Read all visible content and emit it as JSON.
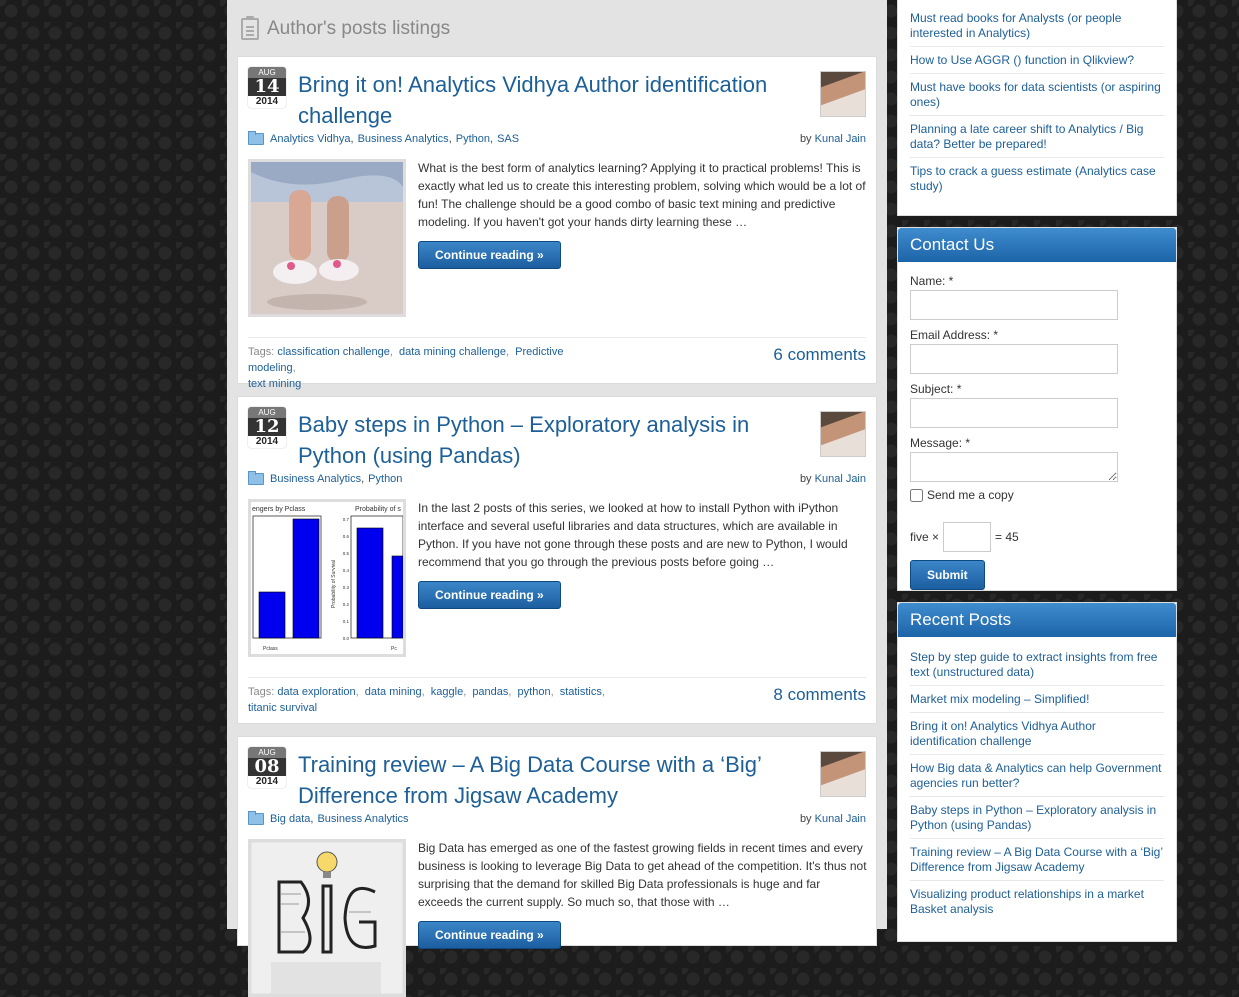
{
  "listing": {
    "title": "Author's posts listings"
  },
  "posts": [
    {
      "month": "AUG",
      "day": "14",
      "year": "2014",
      "title": "Bring it on! Analytics Vidhya Author identification challenge",
      "categories": [
        "Analytics Vidhya",
        "Business Analytics",
        "Python",
        "SAS"
      ],
      "by": "by",
      "author": "Kunal Jain",
      "excerpt": "What is the best form of analytics learning? Applying it to practical problems! This is exactly what led us to create this interesting problem, solving which would be a lot of fun! The challenge should be a good combo of basic text mining and predictive modeling. If you haven't got your hands dirty learning these …",
      "continue_label": "Continue reading »",
      "tags_label": "Tags:",
      "tags": [
        "classification challenge",
        "data mining challenge",
        "Predictive modeling",
        "text mining"
      ],
      "comments": "6 comments"
    },
    {
      "month": "AUG",
      "day": "12",
      "year": "2014",
      "title": "Baby steps in Python – Exploratory analysis in Python (using Pandas)",
      "categories": [
        "Business Analytics",
        "Python"
      ],
      "by": "by",
      "author": "Kunal Jain",
      "excerpt": "In the last 2 posts of this series, we looked at how to install Python with iPython interface and several useful libraries and data structures, which are available in Python. If you have not gone through these posts and are new to Python, I would recommend that you go through the previous posts before going …",
      "continue_label": "Continue reading »",
      "tags_label": "Tags:",
      "tags": [
        "data exploration",
        "data mining",
        "kaggle",
        "pandas",
        "python",
        "statistics",
        "titanic survival"
      ],
      "comments": "8 comments",
      "thumb_text": {
        "title_left": "engers by Pclass",
        "title_right": "Probability of s",
        "ylabel": "Probability of Survival",
        "xlabel_left": "Pclass",
        "xlabel_right": "Pc",
        "yticks": [
          "0.7",
          "0.6",
          "0.5",
          "0.4",
          "0.3",
          "0.2",
          "0.1",
          "0.0"
        ]
      }
    },
    {
      "month": "AUG",
      "day": "08",
      "year": "2014",
      "title": "Training review – A Big Data Course with a ‘Big’ Difference from Jigsaw Academy",
      "categories": [
        "Big data",
        "Business Analytics"
      ],
      "by": "by",
      "author": "Kunal Jain",
      "excerpt": "Big Data has emerged as one of the fastest growing fields in recent times and every business is looking to leverage Big Data to get ahead of the competition. It's thus not surprising that the demand for skilled Big Data professionals is huge and far exceeds the current supply. So much so, that those with …",
      "continue_label": "Continue reading »"
    }
  ],
  "sidebar": {
    "top_links": [
      "Must read books for Analysts (or people interested in Analytics)",
      "How to Use AGGR () function in Qlikview?",
      "Must have books for data scientists (or aspiring ones)",
      "Planning a late career shift to Analytics / Big data? Better be prepared!",
      "Tips to crack a guess estimate (Analytics case study)"
    ],
    "contact": {
      "title": "Contact Us",
      "name_label": "Name: *",
      "email_label": "Email Address: *",
      "subject_label": "Subject: *",
      "message_label": "Message: *",
      "copy_label": "Send me a copy",
      "captcha_left": "five ×",
      "captcha_right": "= 45",
      "submit_label": "Submit"
    },
    "recent": {
      "title": "Recent Posts",
      "items": [
        "Step by step guide to extract insights from free text (unstructured data)",
        "Market mix modeling – Simplified!",
        "Bring it on! Analytics Vidhya Author identification challenge",
        "How Big data & Analytics can help Government agencies run better?",
        "Baby steps in Python – Exploratory analysis in Python (using Pandas)",
        "Training review – A Big Data Course with a ‘Big’ Difference from Jigsaw Academy",
        "Visualizing product relationships in a market Basket analysis"
      ]
    }
  },
  "colors": {
    "link": "#1d5f97",
    "button": "#1c5ea0",
    "widget_header": "#2a73b8"
  }
}
